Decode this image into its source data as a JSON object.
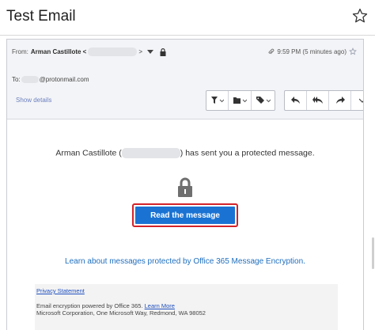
{
  "window": {
    "title": "Test Email",
    "favorite_icon": "star-outline-icon"
  },
  "header": {
    "from_label": "From:",
    "from_name": "Arman Castillote <",
    "from_close": ">",
    "time": "9:59 PM (5 minutes ago)",
    "to_label": "To:",
    "to_domain": "@protonmail.com",
    "show_details": "Show details",
    "toolbar_icons": [
      "filter-icon",
      "folder-icon",
      "tag-icon",
      "reply-icon",
      "reply-all-icon",
      "forward-icon"
    ]
  },
  "body": {
    "sent_prefix": "Arman Castillote (",
    "sent_suffix": ") has sent you a protected message.",
    "read_button": "Read the message",
    "learn_link": "Learn about messages protected by Office 365 Message Encryption."
  },
  "footer": {
    "privacy": "Privacy Statement",
    "line1": "Email encryption powered by Office 365. ",
    "learn_more": "Learn More",
    "line2": "Microsoft Corporation, One Microsoft Way, Redmond, WA 98052"
  },
  "colors": {
    "accent_button": "#1a73d3",
    "highlight_border": "#d3222a",
    "link": "#1f6fbf"
  }
}
